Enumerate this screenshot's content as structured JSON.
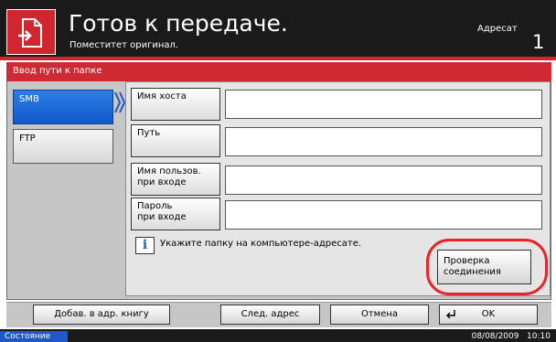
{
  "header": {
    "title": "Готов к передаче.",
    "subtitle": "Поместитет оригинал.",
    "destination_label": "Адресат",
    "destination_count": "1",
    "icon": "document-send-icon"
  },
  "panel": {
    "title": "Ввод пути к папке",
    "protocols": [
      {
        "label": "SMB",
        "selected": true
      },
      {
        "label": "FTP",
        "selected": false
      }
    ],
    "fields": [
      {
        "label": "Имя хоста",
        "value": ""
      },
      {
        "label": "Путь",
        "value": ""
      },
      {
        "label_line1": "Имя пользов.",
        "label_line2": "при входе",
        "value": ""
      },
      {
        "label_line1": "Пароль",
        "label_line2": "при входе",
        "value": ""
      }
    ],
    "info_text": "Укажите папку на компьютере-адресате.",
    "check_button": {
      "line1": "Проверка",
      "line2": "соединения"
    }
  },
  "toolbar": {
    "add_to_book": "Добав. в адр. книгу",
    "next_address": "След. адрес",
    "cancel": "Отмена",
    "ok": "OK"
  },
  "status": {
    "label": "Состояние",
    "datetime": "08/08/2009   10:10"
  },
  "colors": {
    "accent_red": "#d0262f",
    "selected_blue": "#1f58c9",
    "highlight_ring": "#e8232a"
  }
}
